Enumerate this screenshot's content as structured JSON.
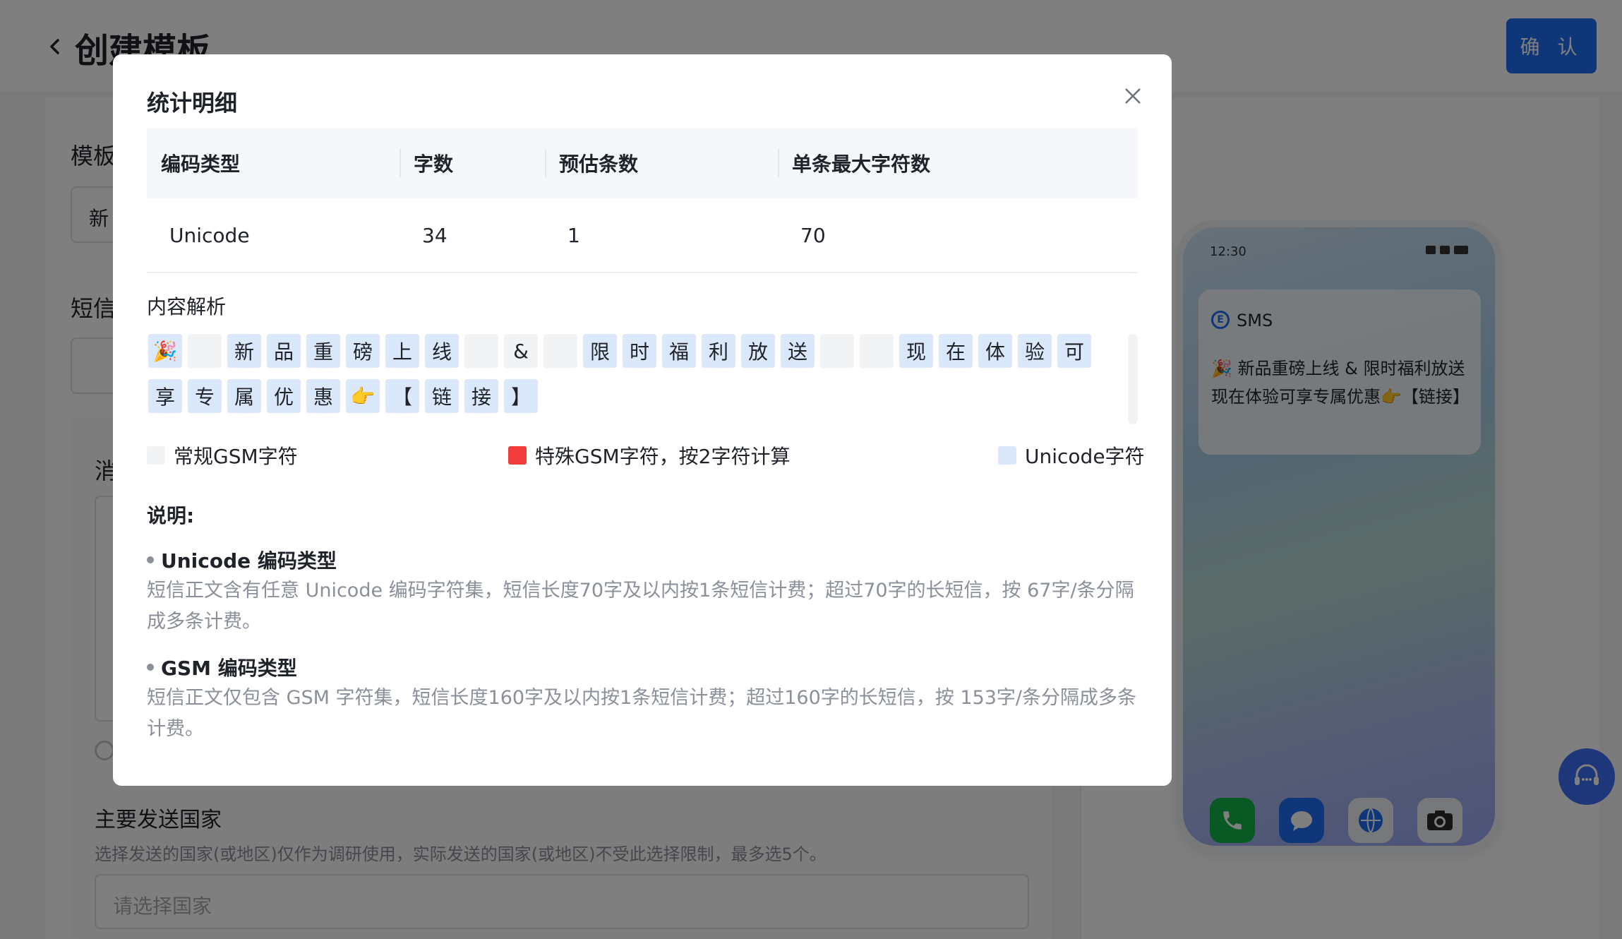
{
  "page": {
    "title": "创建模板",
    "confirm_label": "确 认",
    "labels": {
      "template": "模板",
      "sms": "短信",
      "message": "消"
    },
    "template_input_value": "新",
    "country_section_title": "主要发送国家",
    "country_section_hint": "选择发送的国家(或地区)仅作为调研使用，实际发送的国家(或地区)不受此选择限制，最多选5个。",
    "country_placeholder": "请选择国家"
  },
  "phone": {
    "time": "12:30",
    "app_name": "SMS",
    "app_icon_letter": "E",
    "message": "🎉 新品重磅上线 & 限时福利放送 现在体验可享专属优惠👉【链接】",
    "dock": [
      "phone-icon",
      "message-icon",
      "browser-icon",
      "camera-icon"
    ]
  },
  "modal": {
    "title": "统计明细",
    "table": {
      "headers": [
        "编码类型",
        "字数",
        "预估条数",
        "单条最大字符数"
      ],
      "rows": [
        [
          "Unicode",
          "34",
          "1",
          "70"
        ]
      ]
    },
    "analysis_label": "内容解析",
    "chars": [
      {
        "c": "🎉",
        "t": "unicode"
      },
      {
        "c": "",
        "t": "gsm"
      },
      {
        "c": "新",
        "t": "unicode"
      },
      {
        "c": "品",
        "t": "unicode"
      },
      {
        "c": "重",
        "t": "unicode"
      },
      {
        "c": "磅",
        "t": "unicode"
      },
      {
        "c": "上",
        "t": "unicode"
      },
      {
        "c": "线",
        "t": "unicode"
      },
      {
        "c": "",
        "t": "gsm"
      },
      {
        "c": "&",
        "t": "gsm"
      },
      {
        "c": "",
        "t": "gsm"
      },
      {
        "c": "限",
        "t": "unicode"
      },
      {
        "c": "时",
        "t": "unicode"
      },
      {
        "c": "福",
        "t": "unicode"
      },
      {
        "c": "利",
        "t": "unicode"
      },
      {
        "c": "放",
        "t": "unicode"
      },
      {
        "c": "送",
        "t": "unicode"
      },
      {
        "c": "",
        "t": "gsm"
      },
      {
        "c": "",
        "t": "gsm"
      },
      {
        "c": "现",
        "t": "unicode"
      },
      {
        "c": "在",
        "t": "unicode"
      },
      {
        "c": "体",
        "t": "unicode"
      },
      {
        "c": "验",
        "t": "unicode"
      },
      {
        "c": "可",
        "t": "unicode"
      },
      {
        "c": "享",
        "t": "unicode"
      },
      {
        "c": "专",
        "t": "unicode"
      },
      {
        "c": "属",
        "t": "unicode"
      },
      {
        "c": "优",
        "t": "unicode"
      },
      {
        "c": "惠",
        "t": "unicode"
      },
      {
        "c": "👉",
        "t": "unicode"
      },
      {
        "c": "【",
        "t": "unicode"
      },
      {
        "c": "链",
        "t": "unicode"
      },
      {
        "c": "接",
        "t": "unicode"
      },
      {
        "c": "】",
        "t": "unicode"
      }
    ],
    "legend": [
      {
        "label": "常规GSM字符",
        "color": "#f2f3f5"
      },
      {
        "label": "特殊GSM字符，按2字符计算",
        "color": "#f23c3c"
      },
      {
        "label": "Unicode字符",
        "color": "#dbe7fb"
      }
    ],
    "notes_title": "说明:",
    "notes": [
      {
        "heading": "Unicode 编码类型",
        "text": "短信正文含有任意 Unicode 编码字符集，短信长度70字及以内按1条短信计费；超过70字的长短信，按 67字/条分隔成多条计费。"
      },
      {
        "heading": "GSM 编码类型",
        "text": "短信正文仅包含 GSM 字符集，短信长度160字及以内按1条短信计费；超过160字的长短信，按 153字/条分隔成多条计费。"
      }
    ]
  }
}
